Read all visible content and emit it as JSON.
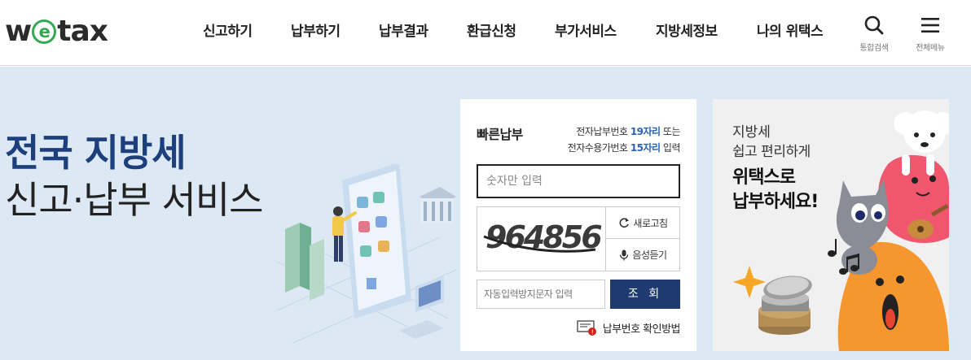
{
  "header": {
    "logo": {
      "pre": "w",
      "mid": "e",
      "post": "tax"
    },
    "nav": [
      "신고하기",
      "납부하기",
      "납부결과",
      "환급신청",
      "부가서비스",
      "지방세정보",
      "나의 위택스"
    ],
    "search_label": "통합검색",
    "menu_label": "전체메뉴"
  },
  "hero": {
    "title": "전국 지방세",
    "subtitle": "신고·납부 서비스"
  },
  "quick_pay": {
    "title": "빠른납부",
    "hint": {
      "line1_pre": "전자납부번호 ",
      "line1_hl": "19자리",
      "line1_post": " 또는",
      "line2_pre": "전자수용가번호 ",
      "line2_hl": "15자리",
      "line2_post": " 입력"
    },
    "number_placeholder": "숫자만 입력",
    "captcha_text": "964856",
    "refresh_label": "새로고침",
    "audio_label": "음성듣기",
    "auto_placeholder": "자동입력방지문자 입력",
    "search_label": "조 회",
    "howto_label": "납부번호 확인방법"
  },
  "promo": {
    "line1": "지방세",
    "line2": "쉽고 편리하게",
    "line3": "위택스로",
    "line4": "납부하세요!",
    "colors": {
      "bg": "#f0f0f0",
      "pink": "#f0566e",
      "orange": "#f5962f",
      "gray_cat": "#8a8d96"
    }
  },
  "colors": {
    "brand_green": "#34a853",
    "navy": "#1e3a6e",
    "hero_bg": "#dce8f4",
    "title_blue": "#1d3f7c",
    "highlight_blue": "#2b62b3"
  }
}
